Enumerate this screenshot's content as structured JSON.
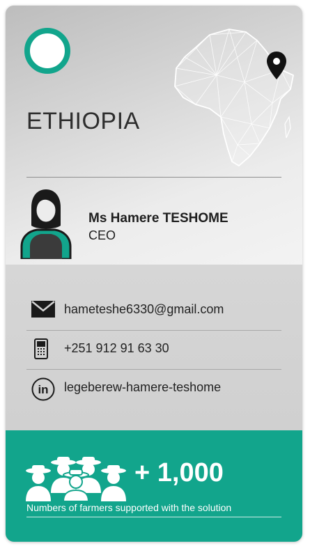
{
  "header": {
    "country": "ETHIOPIA",
    "accent_color": "#12a58c",
    "map_icon": "africa-map-icon",
    "pin_icon": "location-pin-icon"
  },
  "profile": {
    "avatar_icon": "woman-avatar-icon",
    "name": "Ms Hamere TESHOME",
    "role": "CEO"
  },
  "contacts": [
    {
      "icon": "envelope-icon",
      "text": "hameteshe6330@gmail.com"
    },
    {
      "icon": "phone-icon",
      "text": "+251 912 91 63 30"
    },
    {
      "icon": "linkedin-icon",
      "text": "legeberew-hamere-teshome"
    }
  ],
  "stats": {
    "icon": "farmers-group-icon",
    "value": "+ 1,000",
    "caption": "Numbers of farmers supported with the solution"
  }
}
